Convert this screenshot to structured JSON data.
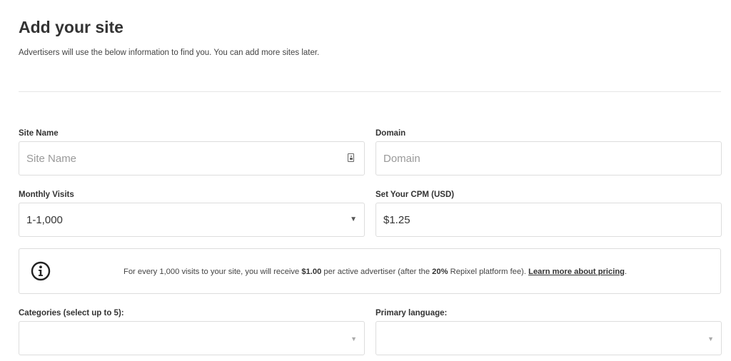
{
  "header": {
    "title": "Add your site",
    "subtitle": "Advertisers will use the below information to find you. You can add more sites later."
  },
  "form": {
    "site_name": {
      "label": "Site Name",
      "placeholder": "Site Name",
      "value": "",
      "icon": "contact-card-icon"
    },
    "domain": {
      "label": "Domain",
      "placeholder": "Domain",
      "value": ""
    },
    "monthly_visits": {
      "label": "Monthly Visits",
      "selected": "1-1,000",
      "icon": "caret-down-icon"
    },
    "cpm": {
      "label": "Set Your CPM (USD)",
      "value": "$1.25"
    },
    "categories": {
      "label": "Categories (select up to 5):",
      "selected": "",
      "icon": "caret-down-icon"
    },
    "primary_language": {
      "label": "Primary language:",
      "selected": "",
      "icon": "caret-down-icon"
    }
  },
  "notice": {
    "icon": "info-circle-icon",
    "text_before": "For every 1,000 visits to your site, you will receive ",
    "amount": "$1.00",
    "text_middle": " per active advertiser (after the ",
    "fee_percent": "20%",
    "text_after": " Repixel platform fee). ",
    "link_label": "Learn more about pricing",
    "period": "."
  },
  "colors": {
    "text": "#333333",
    "border": "#dddddd",
    "placeholder": "#999999",
    "background": "#ffffff"
  }
}
